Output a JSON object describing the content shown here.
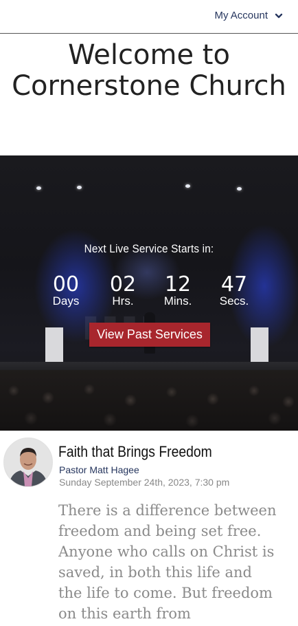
{
  "nav": {
    "account_label": "My Account"
  },
  "welcome": {
    "title": "Welcome to Cornerstone Church"
  },
  "hero": {
    "countdown_heading": "Next Live Service Starts in:",
    "countdown": [
      {
        "value": "00",
        "unit": "Days"
      },
      {
        "value": "02",
        "unit": "Hrs."
      },
      {
        "value": "12",
        "unit": "Mins."
      },
      {
        "value": "47",
        "unit": "Secs."
      }
    ],
    "button_label": "View Past Services"
  },
  "sermon": {
    "title": "Faith that Brings Freedom",
    "pastor": "Pastor Matt Hagee",
    "date": "Sunday September 24th, 2023, 7:30 pm",
    "description": "There is a difference between freedom and being set free. Anyone who calls on Christ is saved, in both this life and the life to come. But freedom on this earth from"
  },
  "colors": {
    "accent_navy": "#26365e",
    "button_red": "#a8262d"
  }
}
